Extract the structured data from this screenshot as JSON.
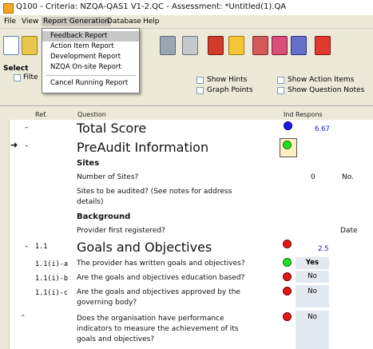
{
  "window": {
    "title": "Q100 - Criteria: NZQA-QAS1 V1-2.QC - Assessment: *Untitled(1).QA"
  },
  "menu": {
    "items": [
      {
        "label": "File"
      },
      {
        "label": "View"
      },
      {
        "label": "Report Generation"
      },
      {
        "label": "Database"
      },
      {
        "label": "Help"
      }
    ],
    "dropdown": [
      {
        "label": "Feedback Report"
      },
      {
        "label": "Action Item Report"
      },
      {
        "label": "Development Report"
      },
      {
        "label": "NZQA On-site Report"
      },
      {
        "label": "Cancel Running Report"
      }
    ]
  },
  "filter": {
    "section_label": "Select",
    "filter_cb_label": "Filte",
    "show_hints": "Show Hints",
    "graph_points": "Graph Points",
    "show_action_items": "Show Action Items",
    "show_question_notes": "Show Question Notes"
  },
  "columns": {
    "ref": "Ref.",
    "question": "Question",
    "ind_respons": "Ind Respons"
  },
  "rows": {
    "total_score": {
      "prefix": "–",
      "question": "Total Score",
      "score": "6.67"
    },
    "preaudit": {
      "marker": "➜",
      "prefix": "–",
      "question": "PreAudit Information"
    },
    "sites": {
      "question": "Sites"
    },
    "num_sites": {
      "question": "Number of Sites?",
      "value": "0",
      "extra": "No."
    },
    "sites_audited": {
      "question_l1": "Sites to be audited? (See notes for address",
      "question_l2": "details)"
    },
    "background": {
      "question": "Background"
    },
    "provider_reg": {
      "question": "Provider first registered?",
      "extra": "Date"
    },
    "goals": {
      "prefix": "–",
      "ref": "1.1",
      "question": "Goals and Objectives",
      "score": "2.5"
    },
    "r1": {
      "ref": "1.1(i)-a",
      "question": "The provider has written goals and objectives?",
      "response": "Yes"
    },
    "r2": {
      "ref": "1.1(i)-b",
      "question": "Are the goals and objectives education based?",
      "response": "No"
    },
    "r3": {
      "ref": "1.1(i)-c",
      "question_l1": "Are the goals and objectives approved by the",
      "question_l2": "governing body?",
      "response": "No"
    },
    "r4": {
      "marker": "ᴬ",
      "question_l1": "Does the organisation have performance",
      "question_l2": "indicators to measure the achievement of its",
      "question_l3": "goals and objectives?",
      "response": "No"
    }
  }
}
